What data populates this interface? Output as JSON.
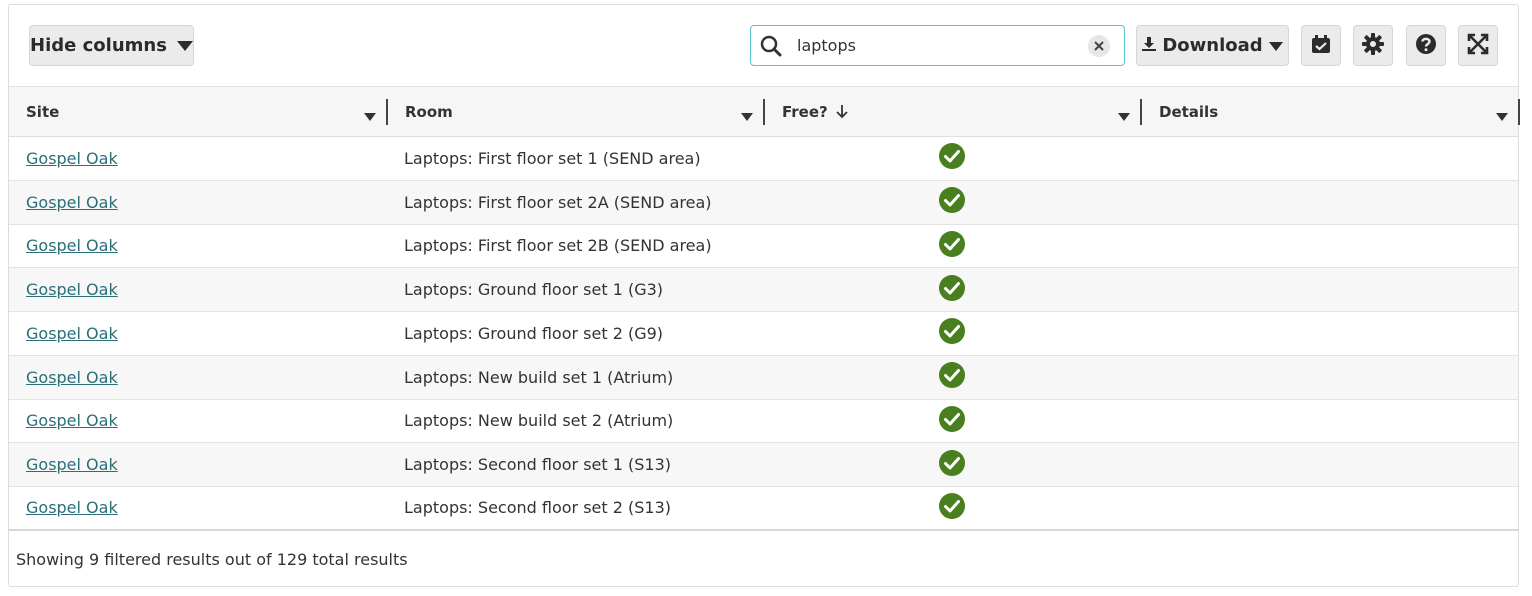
{
  "toolbar": {
    "hide_columns_label": "Hide columns",
    "search_value": "laptops",
    "download_label": "Download",
    "icons": [
      "calendar-check-icon",
      "gear-icon",
      "help-icon",
      "expand-icon"
    ]
  },
  "columns": [
    {
      "label": "Site",
      "sorted": false
    },
    {
      "label": "Room",
      "sorted": false
    },
    {
      "label": "Free?",
      "sorted": true,
      "sort_direction": "descending"
    },
    {
      "label": "Details",
      "sorted": false
    }
  ],
  "rows": [
    {
      "site": "Gospel Oak",
      "room": "Laptops: First floor set 1 (SEND area)",
      "free": true
    },
    {
      "site": "Gospel Oak",
      "room": "Laptops: First floor set 2A (SEND area)",
      "free": true
    },
    {
      "site": "Gospel Oak",
      "room": "Laptops: First floor set 2B (SEND area)",
      "free": true
    },
    {
      "site": "Gospel Oak",
      "room": "Laptops: Ground floor set 1 (G3)",
      "free": true
    },
    {
      "site": "Gospel Oak",
      "room": "Laptops: Ground floor set 2 (G9)",
      "free": true
    },
    {
      "site": "Gospel Oak",
      "room": "Laptops: New build set 1 (Atrium)",
      "free": true
    },
    {
      "site": "Gospel Oak",
      "room": "Laptops: New build set 2 (Atrium)",
      "free": true
    },
    {
      "site": "Gospel Oak",
      "room": "Laptops: Second floor set 1 (S13)",
      "free": true
    },
    {
      "site": "Gospel Oak",
      "room": "Laptops: Second floor set 2 (S13)",
      "free": true
    }
  ],
  "footer": {
    "status": "Showing 9 filtered results out of 129 total results"
  },
  "colors": {
    "search_border": "#56c4cf",
    "link": "#2a6f78",
    "check": "#4a7f1f"
  }
}
